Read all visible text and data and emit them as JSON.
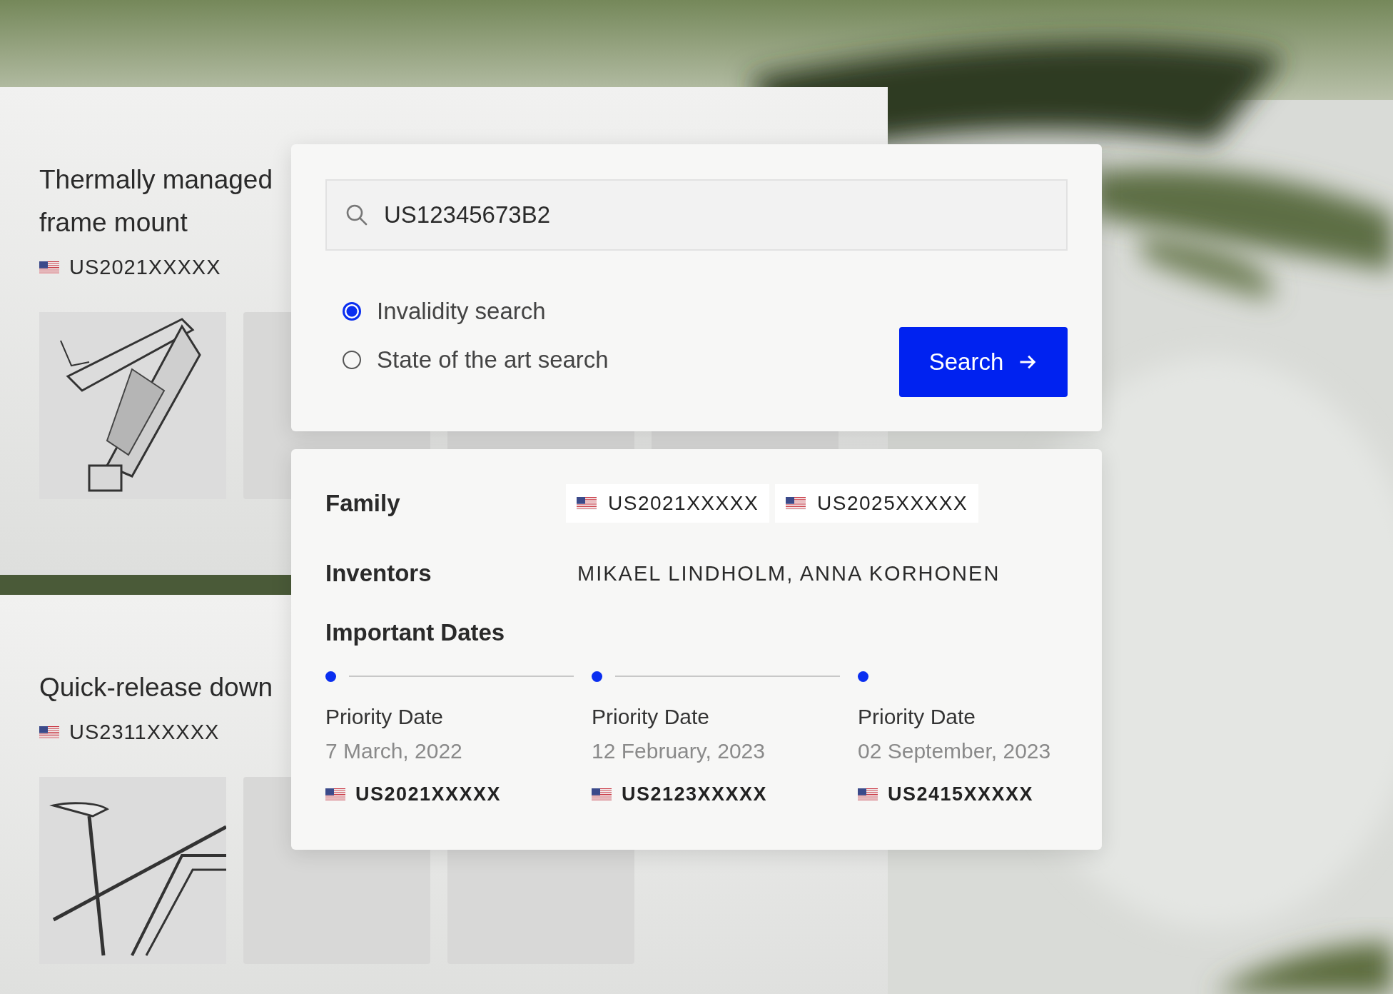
{
  "patent_cards": [
    {
      "title": "Thermally managed frame mount",
      "number": "US2021XXXXX",
      "thumbnails": [
        {
          "kind": "frame-drawing"
        },
        {
          "kind": "blank"
        },
        {
          "kind": "blank"
        },
        {
          "kind": "blank"
        }
      ]
    },
    {
      "title": "Quick-release down",
      "number": "US2311XXXXX",
      "thumbnails": [
        {
          "kind": "bike-drawing"
        },
        {
          "kind": "blank"
        },
        {
          "kind": "blank"
        }
      ]
    }
  ],
  "search": {
    "value": "US12345673B2",
    "options": [
      {
        "label": "Invalidity search",
        "selected": true
      },
      {
        "label": "State of the art search",
        "selected": false
      }
    ],
    "button": "Search"
  },
  "details": {
    "family": {
      "label": "Family",
      "chips": [
        "US2021XXXXX",
        "US2025XXXXX"
      ]
    },
    "inventors": {
      "label": "Inventors",
      "value": "MIKAEL LINDHOLM, ANNA KORHONEN"
    },
    "dates": {
      "title": "Important Dates",
      "items": [
        {
          "label": "Priority Date",
          "date": "7 March, 2022",
          "number": "US2021XXXXX"
        },
        {
          "label": "Priority Date",
          "date": "12 February, 2023",
          "number": "US2123XXXXX"
        },
        {
          "label": "Priority Date",
          "date": "02 September, 2023",
          "number": "US2415XXXXX"
        }
      ]
    }
  }
}
